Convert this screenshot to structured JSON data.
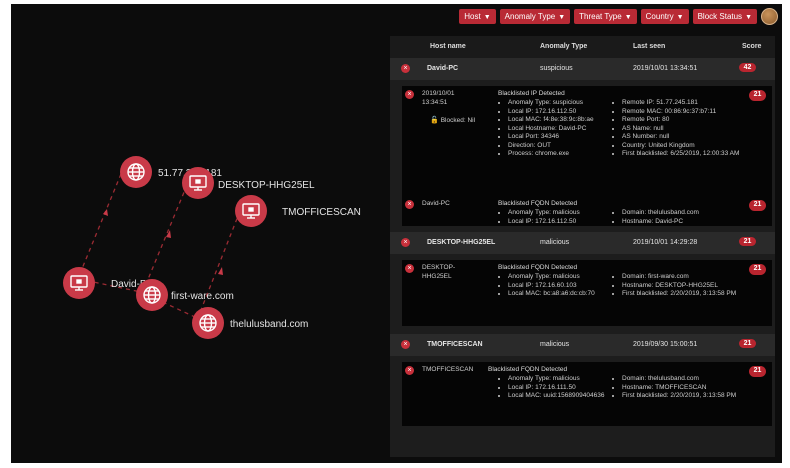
{
  "filters": [
    {
      "label": "Host"
    },
    {
      "label": "Anomaly Type"
    },
    {
      "label": "Threat Type"
    },
    {
      "label": "Country"
    },
    {
      "label": "Block Status"
    }
  ],
  "graph": {
    "nodes": [
      {
        "label": "51.77.245.181",
        "icon": "globe-icon"
      },
      {
        "label": "DESKTOP-HHG25EL",
        "icon": "computer-icon"
      },
      {
        "label": "TMOFFICESCAN",
        "icon": "computer-icon"
      },
      {
        "label": "David-PC",
        "icon": "computer-icon"
      },
      {
        "label": "first-ware.com",
        "icon": "globe-icon"
      },
      {
        "label": "thelulusband.com",
        "icon": "globe-icon"
      }
    ]
  },
  "table": {
    "columns": {
      "host": "Host name",
      "anomaly": "Anomaly Type",
      "last_seen": "Last seen",
      "score": "Score"
    },
    "groups": [
      {
        "host": "David-PC",
        "anomaly": "suspicious",
        "last_seen": "2019/10/01 13:34:51",
        "score": "42",
        "alerts": [
          {
            "left": "2019/10/01\n13:34:51",
            "blocked": "Blocked: Nil",
            "title": "Blacklisted IP Detected",
            "score": "21",
            "col1": [
              "Anomaly Type: suspicious",
              "Local IP: 172.16.112.50",
              "Local MAC: f4:8e:38:9c:8b:ae",
              "Local Hostname: David-PC",
              "Local Port: 34346",
              "Direction: OUT",
              "Process: chrome.exe"
            ],
            "col2": [
              "Remote IP: 51.77.245.181",
              "Remote MAC: 00:86:9c:37:b7:11",
              "Remote Port: 80",
              "AS Name: null",
              "AS Number: null",
              "Country: United Kingdom",
              "First blacklisted: 6/25/2019, 12:00:33 AM"
            ]
          },
          {
            "left": "David-PC",
            "blocked": "",
            "title": "Blacklisted FQDN Detected",
            "score": "21",
            "col1": [
              "Anomaly Type: malicious",
              "Local IP: 172.16.112.50"
            ],
            "col2": [
              "Domain: thelulusband.com",
              "Hostname: David-PC"
            ]
          }
        ]
      },
      {
        "host": "DESKTOP-HHG25EL",
        "anomaly": "malicious",
        "last_seen": "2019/10/01 14:29:28",
        "score": "21",
        "alerts": [
          {
            "left": "DESKTOP-\nHHG25EL",
            "blocked": "",
            "title": "Blacklisted FQDN Detected",
            "score": "21",
            "col1": [
              "Anomaly Type: malicious",
              "Local IP: 172.16.60.103",
              "Local MAC: bc:a8:a6:dc:cb:70"
            ],
            "col2": [
              "Domain: first-ware.com",
              "Hostname: DESKTOP-HHG25EL",
              "First blacklisted: 2/20/2019, 3:13:58 PM"
            ]
          }
        ]
      },
      {
        "host": "TMOFFICESCAN",
        "anomaly": "malicious",
        "last_seen": "2019/09/30 15:00:51",
        "score": "21",
        "alerts": [
          {
            "left": "TMOFFICESCAN",
            "blocked": "",
            "title": "Blacklisted FQDN Detected",
            "score": "21",
            "col1": [
              "Anomaly Type: malicious",
              "Local IP: 172.16.111.50",
              "Local MAC: uuid:1568909404636"
            ],
            "col2": [
              "Domain: thelulusband.com",
              "Hostname: TMOFFICESCAN",
              "First blacklisted: 2/20/2019, 3:13:58 PM"
            ]
          }
        ]
      }
    ]
  },
  "colors": {
    "accent": "#b92a35",
    "node": "#c93a48",
    "edge": "#9b2b33",
    "panel": "#1d1d1d",
    "background": "#0c0c0c"
  }
}
